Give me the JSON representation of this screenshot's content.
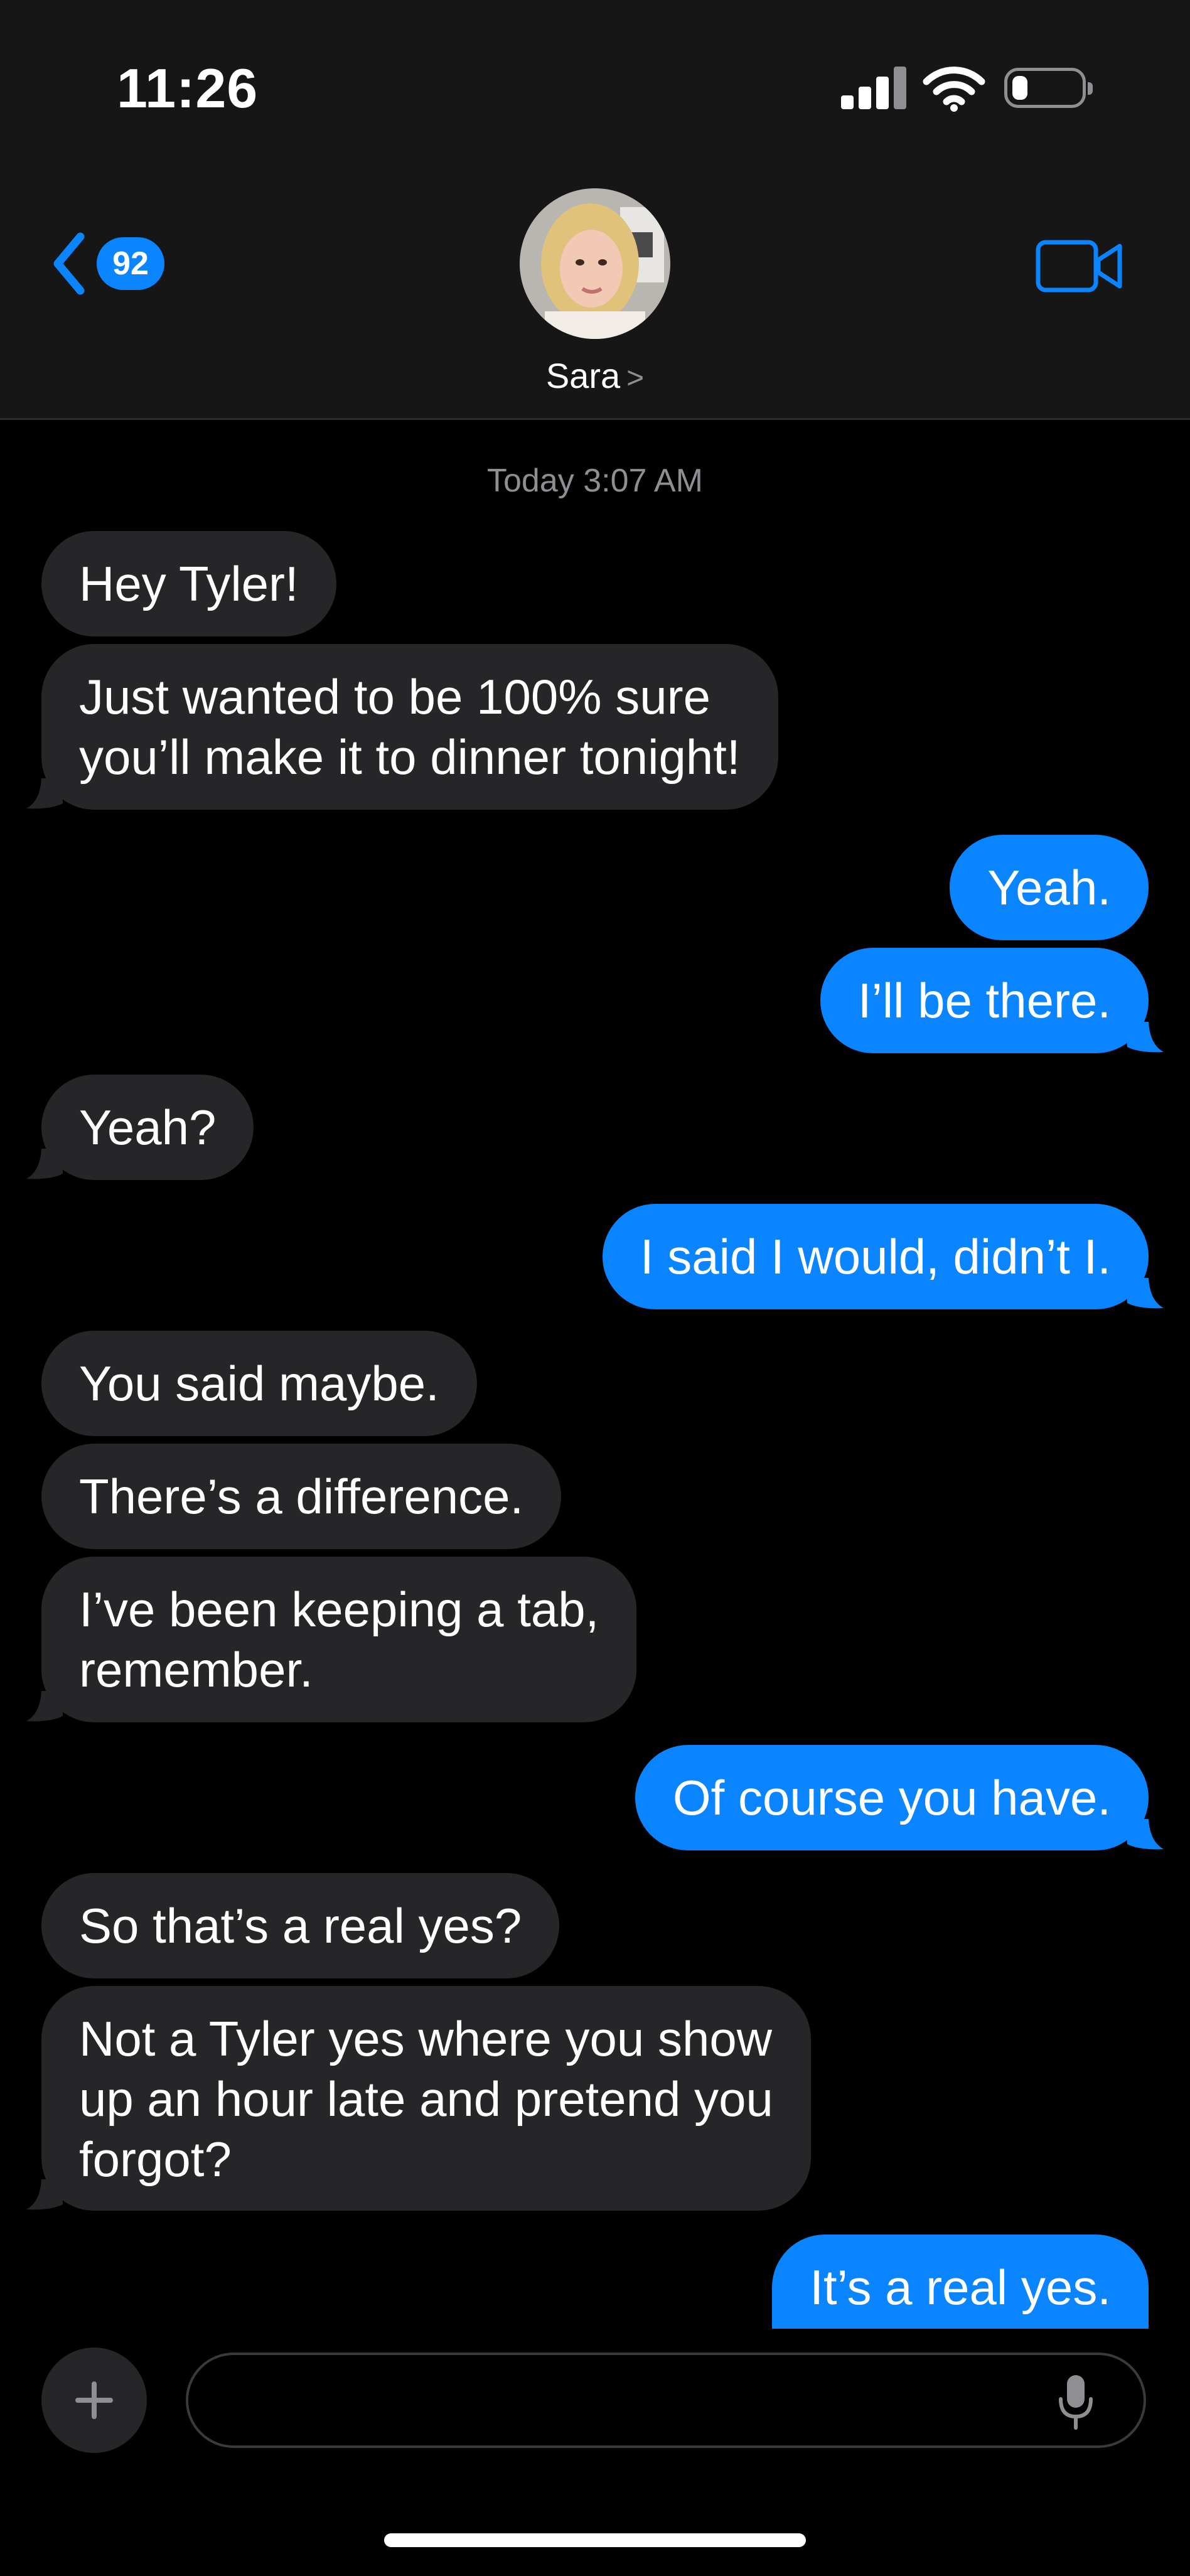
{
  "status_bar": {
    "time": "11:26"
  },
  "header": {
    "back_badge": "92",
    "contact_name": "Sara",
    "contact_chevron": ">",
    "accent_color": "#0a84ff"
  },
  "conversation": {
    "timestamp": "Today 3:07 AM",
    "messages": [
      {
        "from": "Sara",
        "text": "Hey Tyler!"
      },
      {
        "from": "Sara",
        "text": "Just wanted to be 100% sure\nyou’ll make it to dinner tonight!"
      },
      {
        "from": "me",
        "text": "Yeah."
      },
      {
        "from": "me",
        "text": "I’ll be there."
      },
      {
        "from": "Sara",
        "text": "Yeah?"
      },
      {
        "from": "me",
        "text": "I said I would, didn’t I."
      },
      {
        "from": "Sara",
        "text": "You said maybe."
      },
      {
        "from": "Sara",
        "text": "There’s a difference."
      },
      {
        "from": "Sara",
        "text": "I’ve been keeping a tab,\nremember."
      },
      {
        "from": "me",
        "text": "Of course you have."
      },
      {
        "from": "Sara",
        "text": "So that’s a real yes?"
      },
      {
        "from": "Sara",
        "text": "Not a Tyler yes where you show\nup an hour late and pretend you\nforgot?"
      },
      {
        "from": "me",
        "text": "It’s a real yes."
      }
    ]
  },
  "composer": {
    "value": "",
    "placeholder": ""
  },
  "icons": [
    "signal-icon",
    "wifi-icon",
    "battery-icon",
    "back-chevron-icon",
    "video-call-icon",
    "plus-icon",
    "microphone-icon"
  ]
}
